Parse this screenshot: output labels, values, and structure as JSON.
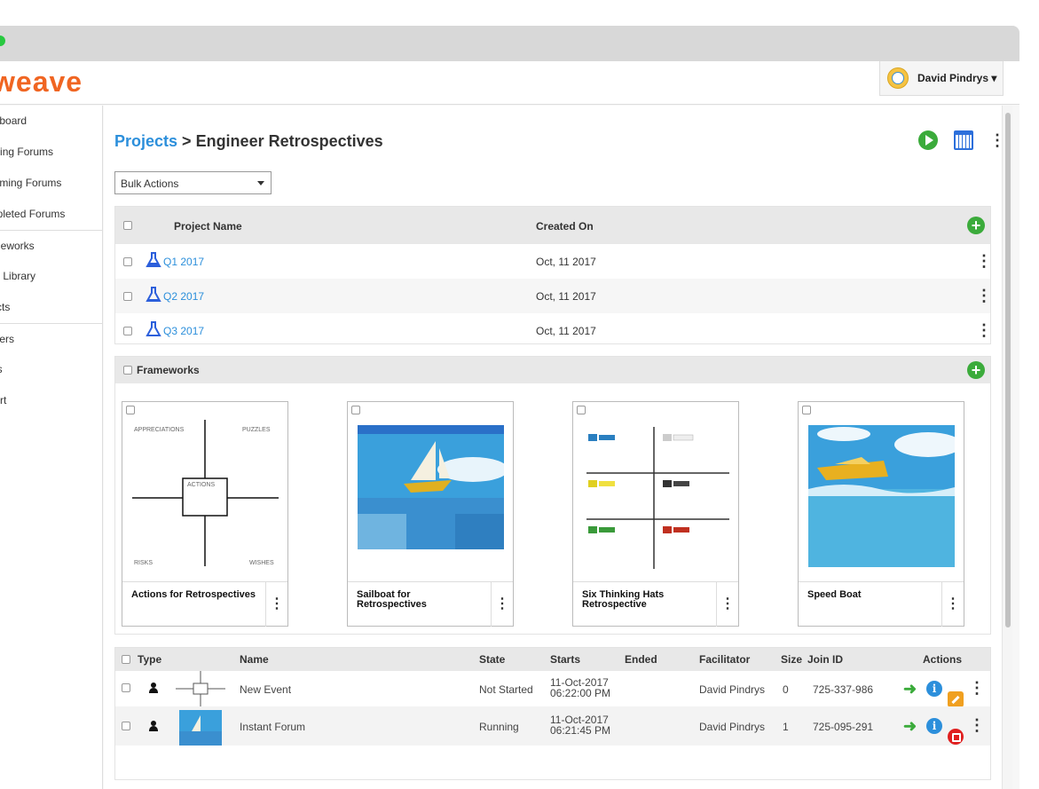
{
  "app": {
    "logo": "weave"
  },
  "user": {
    "name": "David Pindrys ▾"
  },
  "sidebar": {
    "items": [
      {
        "label": "ashboard"
      },
      {
        "label": "unning Forums"
      },
      {
        "label": "pcoming Forums"
      },
      {
        "label": "ompleted Forums"
      },
      {
        "label": "rameworks"
      },
      {
        "label": "age Library"
      },
      {
        "label": "ojects"
      },
      {
        "label": "eavers"
      },
      {
        "label": "ents"
      },
      {
        "label": "pport"
      }
    ]
  },
  "breadcrumb": {
    "projects": "Projects",
    "separator": " > ",
    "current": "Engineer Retrospectives"
  },
  "bulk_actions": {
    "label": "Bulk Actions"
  },
  "projects_table": {
    "headers": {
      "name": "Project Name",
      "created": "Created On"
    },
    "rows": [
      {
        "name": "Q1 2017",
        "created": "Oct, 11 2017"
      },
      {
        "name": "Q2 2017",
        "created": "Oct, 11 2017"
      },
      {
        "name": "Q3 2017",
        "created": "Oct, 11 2017"
      }
    ]
  },
  "frameworks": {
    "header": "Frameworks",
    "cards": [
      {
        "title": "Actions for Retrospectives",
        "labels": {
          "tl": "APPRECIATIONS",
          "tr": "PUZZLES",
          "c": "ACTIONS",
          "bl": "RISKS",
          "br": "WISHES"
        }
      },
      {
        "title": "Sailboat for Retrospectives"
      },
      {
        "title": "Six Thinking Hats Retrospective"
      },
      {
        "title": "Speed Boat"
      }
    ]
  },
  "events_table": {
    "headers": {
      "type": "Type",
      "name": "Name",
      "state": "State",
      "starts": "Starts",
      "ended": "Ended",
      "facilitator": "Facilitator",
      "size": "Size",
      "join_id": "Join ID",
      "actions": "Actions"
    },
    "rows": [
      {
        "name": "New Event",
        "state": "Not Started",
        "starts_date": "11-Oct-2017",
        "starts_time": "06:22:00 PM",
        "ended": "",
        "facilitator": "David Pindrys",
        "size": "0",
        "join_id": "725-337-986"
      },
      {
        "name": "Instant Forum",
        "state": "Running",
        "starts_date": "11-Oct-2017",
        "starts_time": "06:21:45 PM",
        "ended": "",
        "facilitator": "David Pindrys",
        "size": "1",
        "join_id": "725-095-291"
      }
    ]
  },
  "colors": {
    "brand": "#f06522",
    "link": "#2c8fdb",
    "green": "#3bab3b",
    "red": "#e02020",
    "orange": "#f0a020"
  }
}
